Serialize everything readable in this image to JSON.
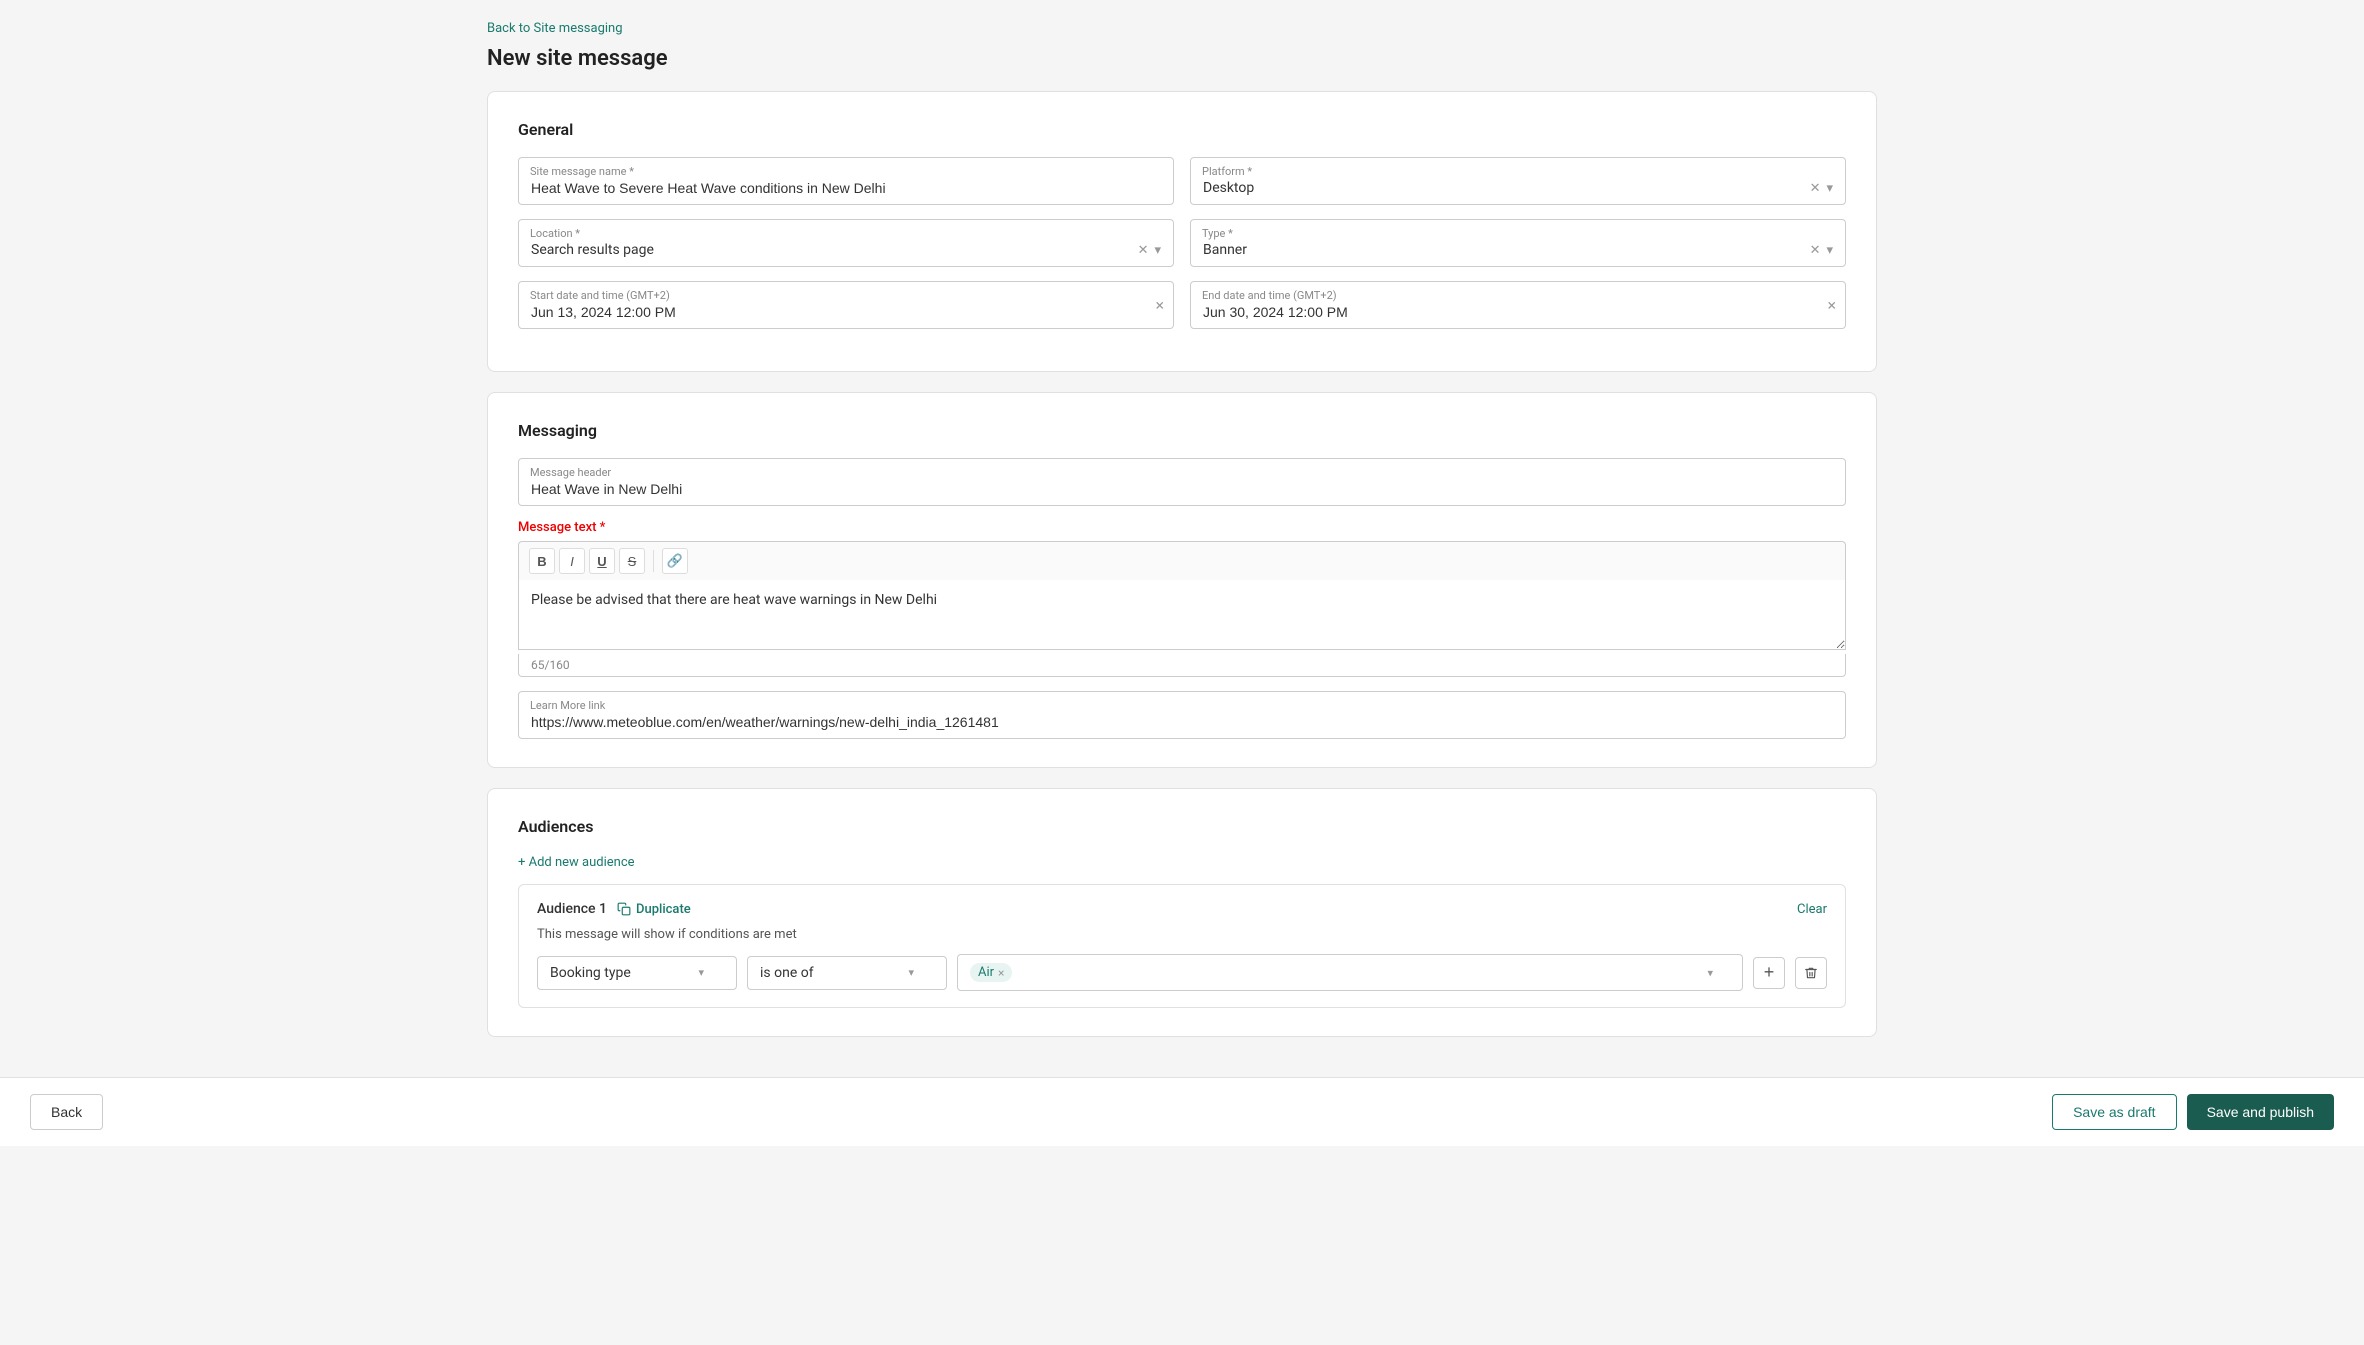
{
  "nav": {
    "back_link": "Back to Site messaging"
  },
  "page": {
    "title": "New site message"
  },
  "general": {
    "section_title": "General",
    "site_message_name_label": "Site message name *",
    "site_message_name_value": "Heat Wave to Severe Heat Wave conditions in New Delhi",
    "platform_label": "Platform *",
    "platform_value": "Desktop",
    "location_label": "Location *",
    "location_value": "Search results page",
    "type_label": "Type *",
    "type_value": "Banner",
    "start_date_label": "Start date and time (GMT+2)",
    "start_date_value": "Jun 13, 2024 12:00 PM",
    "end_date_label": "End date and time (GMT+2)",
    "end_date_value": "Jun 30, 2024 12:00 PM"
  },
  "messaging": {
    "section_title": "Messaging",
    "message_header_label": "Message header",
    "message_header_value": "Heat Wave in New Delhi",
    "message_text_label": "Message text *",
    "toolbar": {
      "bold": "B",
      "italic": "I",
      "underline": "U",
      "strikethrough": "S",
      "link": "🔗"
    },
    "message_text_value": "Please be advised that there are heat wave warnings in New Delhi",
    "char_count": "65/160",
    "learn_more_label": "Learn More link",
    "learn_more_value": "https://www.meteoblue.com/en/weather/warnings/new-delhi_india_1261481"
  },
  "audiences": {
    "section_title": "Audiences",
    "add_audience_label": "+ Add new audience",
    "audience_1": {
      "title": "Audience 1",
      "duplicate_label": "Duplicate",
      "clear_label": "Clear",
      "condition_text": "This message will show if conditions are met",
      "booking_type_label": "Booking type",
      "operator_label": "is one of",
      "value_tag": "Air",
      "plus_btn": "+",
      "trash_btn": "🗑"
    }
  },
  "footer": {
    "back_label": "Back",
    "save_draft_label": "Save as draft",
    "save_publish_label": "Save and publish"
  }
}
